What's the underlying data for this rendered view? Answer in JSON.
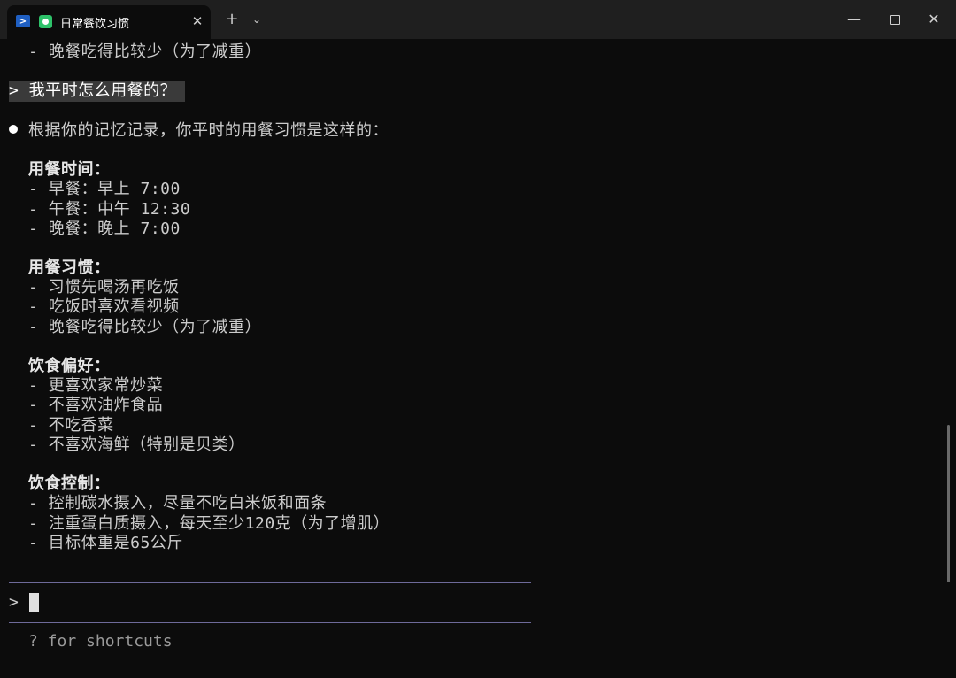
{
  "window": {
    "tab_title": "日常餐饮习惯",
    "tab_close": "✕",
    "new_tab": "+",
    "dropdown": "⌄",
    "minimize": "—",
    "close": "✕"
  },
  "terminal": {
    "prev_line": "- 晚餐吃得比较少（为了减重）",
    "user_prompt": "> 我平时怎么用餐的？",
    "response_intro": "根据你的记忆记录，你平时的用餐习惯是这样的：",
    "sections": [
      {
        "heading": "用餐时间：",
        "items": [
          "- 早餐：早上 7:00",
          "- 午餐：中午 12:30",
          "- 晚餐：晚上 7:00"
        ]
      },
      {
        "heading": "用餐习惯：",
        "items": [
          "- 习惯先喝汤再吃饭",
          "- 吃饭时喜欢看视频",
          "- 晚餐吃得比较少（为了减重）"
        ]
      },
      {
        "heading": "饮食偏好：",
        "items": [
          "- 更喜欢家常炒菜",
          "- 不喜欢油炸食品",
          "- 不吃香菜",
          "- 不喜欢海鲜（特别是贝类）"
        ]
      },
      {
        "heading": "饮食控制：",
        "items": [
          "- 控制碳水摄入，尽量不吃白米饭和面条",
          "- 注重蛋白质摄入，每天至少120克（为了增肌）",
          "- 目标体重是65公斤"
        ]
      }
    ]
  },
  "input": {
    "prompt": ">",
    "shortcuts_hint": "? for shortcuts"
  }
}
